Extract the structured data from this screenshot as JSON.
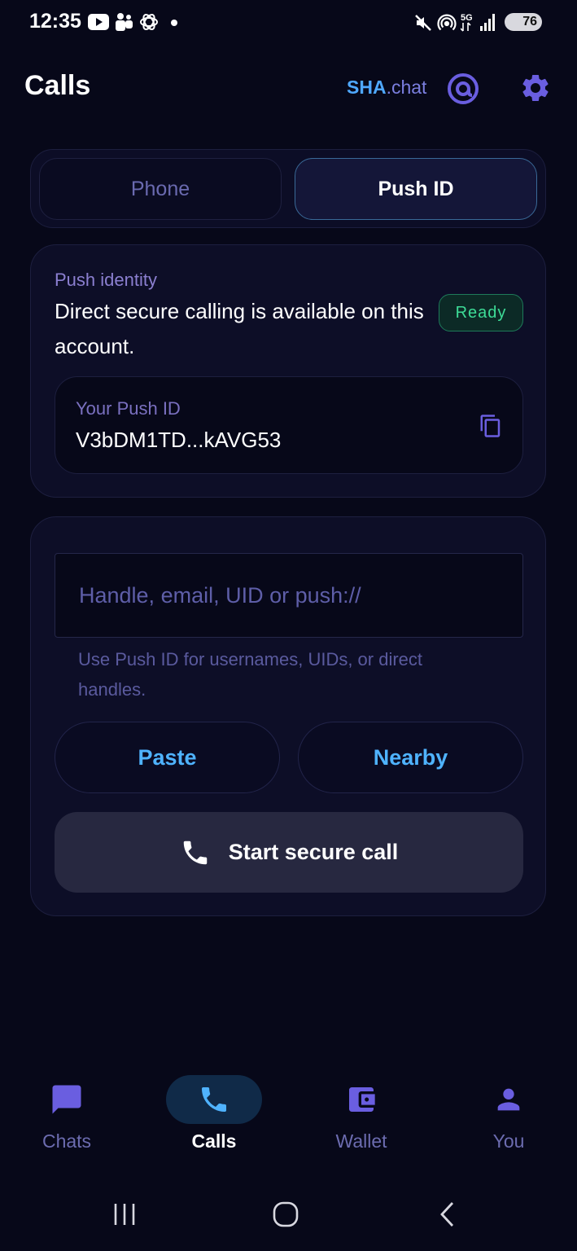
{
  "status_bar": {
    "time": "12:35",
    "battery": "76"
  },
  "header": {
    "title": "Calls",
    "brand_bold": "SHA",
    "brand_rest": ".chat"
  },
  "segments": {
    "phone": "Phone",
    "push_id": "Push ID",
    "active": "Push ID"
  },
  "identity": {
    "label": "Push identity",
    "description": "Direct secure calling is available on this account.",
    "badge": "Ready",
    "push_id_label": "Your Push ID",
    "push_id_value": "V3bDM1TD...kAVG53"
  },
  "call": {
    "input_placeholder": "Handle, email, UID or push://",
    "input_value": "",
    "helper": "Use Push ID for usernames, UIDs, or direct handles.",
    "paste_label": "Paste",
    "nearby_label": "Nearby",
    "start_label": "Start secure call"
  },
  "nav": {
    "items": [
      {
        "label": "Chats",
        "icon": "chat-icon"
      },
      {
        "label": "Calls",
        "icon": "phone-icon"
      },
      {
        "label": "Wallet",
        "icon": "wallet-icon"
      },
      {
        "label": "You",
        "icon": "person-icon"
      }
    ],
    "active": "Calls"
  },
  "colors": {
    "background": "#070819",
    "accent_blue": "#4fb3ff",
    "ready_green": "#3ddc97",
    "muted_purple": "#6c6cb0"
  }
}
